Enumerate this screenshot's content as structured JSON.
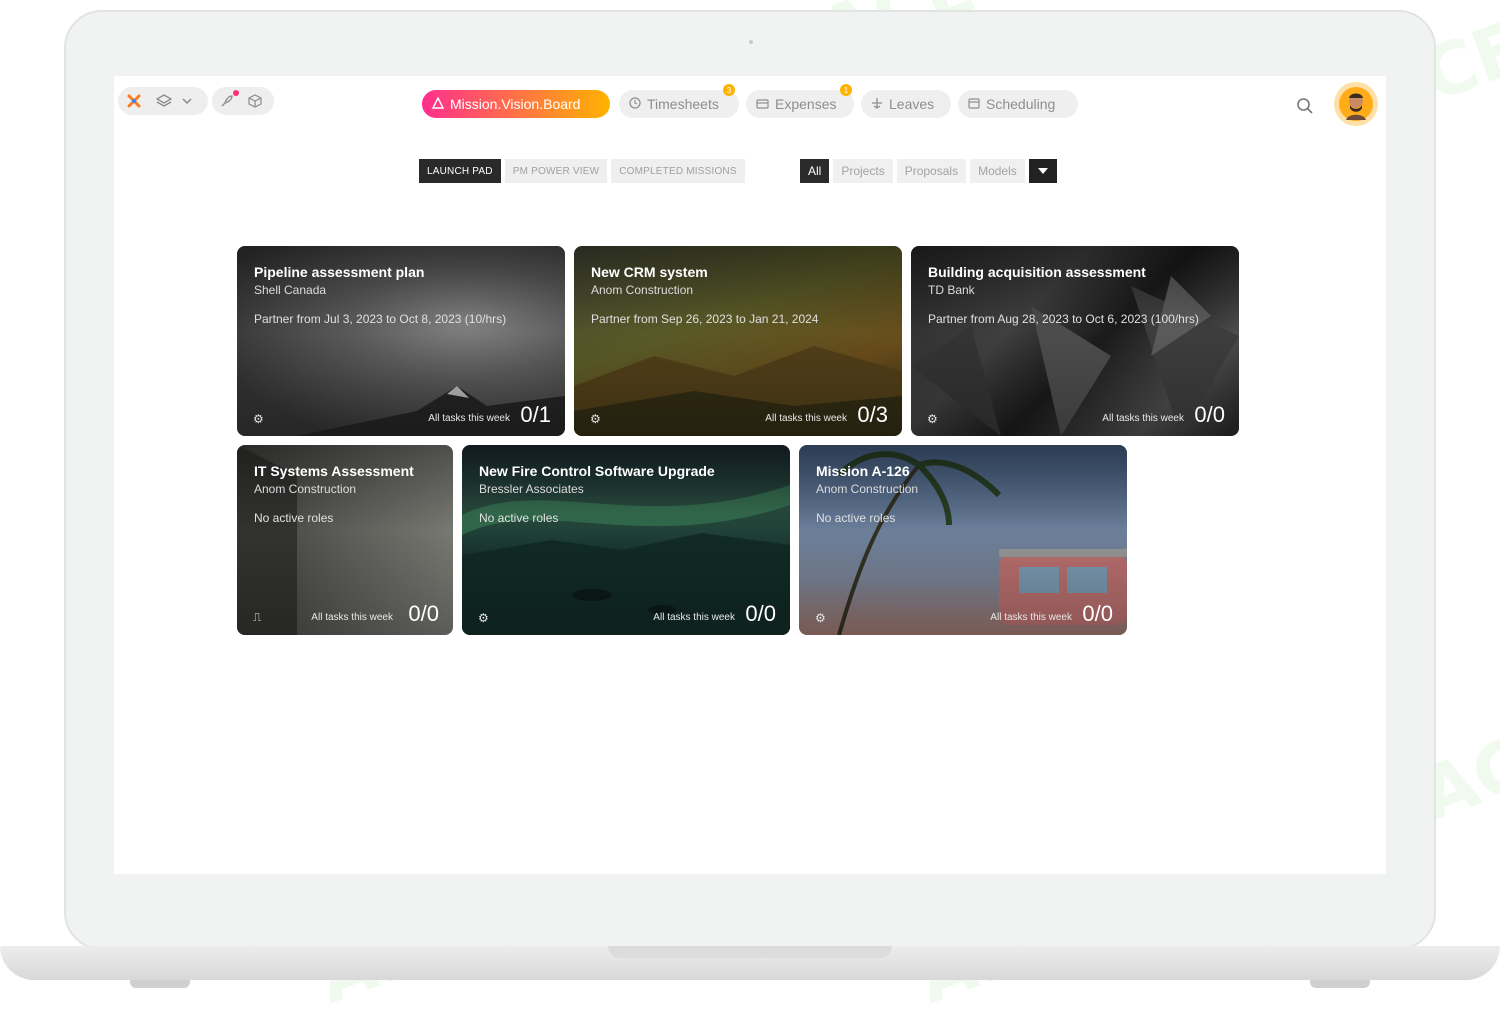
{
  "topbar": {
    "nav": [
      {
        "label": "Mission.Vision.Board",
        "icon": "warning-icon",
        "active": true
      },
      {
        "label": "Timesheets",
        "icon": "clock-icon",
        "badge": "3"
      },
      {
        "label": "Expenses",
        "icon": "card-icon",
        "badge": "1"
      },
      {
        "label": "Leaves",
        "icon": "plane-icon"
      },
      {
        "label": "Scheduling",
        "icon": "calendar-icon"
      }
    ]
  },
  "view_tabs": [
    "LAUNCH PAD",
    "PM POWER VIEW",
    "COMPLETED MISSIONS"
  ],
  "filters": [
    "All",
    "Projects",
    "Proposals",
    "Models"
  ],
  "cards": [
    {
      "title": "Pipeline assessment plan",
      "client": "Shell Canada",
      "detail": "Partner from Jul 3, 2023 to Oct 8, 2023 (10/hrs)",
      "week": "All tasks this week",
      "count": "0/1"
    },
    {
      "title": "New CRM system",
      "client": "Anom Construction",
      "detail": "Partner from Sep 26, 2023 to Jan 21, 2024",
      "week": "All tasks this week",
      "count": "0/3"
    },
    {
      "title": "Building acquisition assessment",
      "client": "TD Bank",
      "detail": "Partner from Aug 28, 2023 to Oct 6, 2023 (100/hrs)",
      "week": "All tasks this week",
      "count": "0/0"
    },
    {
      "title": "IT Systems Assessment",
      "client": "Anom Construction",
      "detail": "No active roles",
      "week": "All tasks this week",
      "count": "0/0"
    },
    {
      "title": "New Fire Control Software Upgrade",
      "client": "Bressler Associates",
      "detail": "No active roles",
      "week": "All tasks this week",
      "count": "0/0"
    },
    {
      "title": "Mission A-126",
      "client": "Anom Construction",
      "detail": "No active roles",
      "week": "All tasks this week",
      "count": "0/0"
    }
  ],
  "watermark": "AI TALENT SPACE",
  "colors": {
    "accent_start": "#ff2f8e",
    "accent_end": "#ffb300",
    "dark": "#2a2a2a"
  }
}
